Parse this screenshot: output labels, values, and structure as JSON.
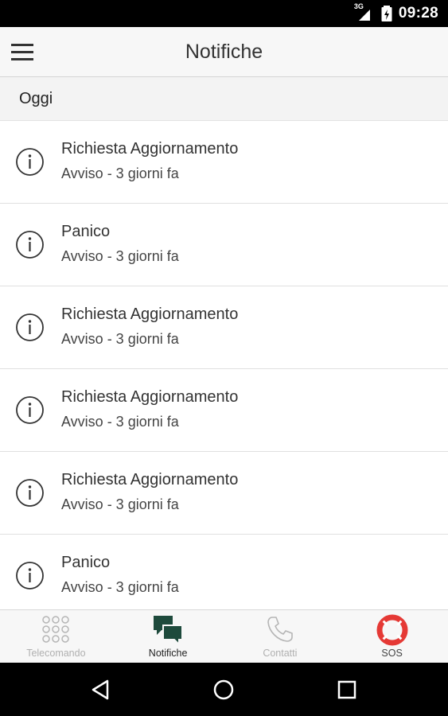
{
  "status_bar": {
    "network": "3G",
    "time": "09:28"
  },
  "header": {
    "title": "Notifiche",
    "menu_icon": "hamburger-menu-icon"
  },
  "section": {
    "label": "Oggi"
  },
  "notifications": [
    {
      "title": "Richiesta Aggiornamento",
      "subtitle": "Avviso - 3 giorni fa",
      "icon": "info-icon"
    },
    {
      "title": "Panico",
      "subtitle": "Avviso - 3 giorni fa",
      "icon": "info-icon"
    },
    {
      "title": "Richiesta Aggiornamento",
      "subtitle": "Avviso - 3 giorni fa",
      "icon": "info-icon"
    },
    {
      "title": "Richiesta Aggiornamento",
      "subtitle": "Avviso - 3 giorni fa",
      "icon": "info-icon"
    },
    {
      "title": "Richiesta Aggiornamento",
      "subtitle": "Avviso - 3 giorni fa",
      "icon": "info-icon"
    },
    {
      "title": "Panico",
      "subtitle": "Avviso - 3 giorni fa",
      "icon": "info-icon"
    }
  ],
  "bottom_nav": {
    "tabs": [
      {
        "label": "Telecomando",
        "icon": "keypad-icon",
        "active": false
      },
      {
        "label": "Notifiche",
        "icon": "chat-bubbles-icon",
        "active": true
      },
      {
        "label": "Contatti",
        "icon": "phone-icon",
        "active": false
      },
      {
        "label": "SOS",
        "icon": "lifebuoy-icon",
        "active": false
      }
    ]
  },
  "colors": {
    "active_tab_icon": "#1e4a3c",
    "inactive_tab": "#b0b0b0",
    "sos_red": "#e53935",
    "app_bar_bg": "#f7f7f7"
  },
  "system_nav": {
    "back_icon": "back-icon",
    "home_icon": "home-icon",
    "recents_icon": "recents-icon"
  }
}
